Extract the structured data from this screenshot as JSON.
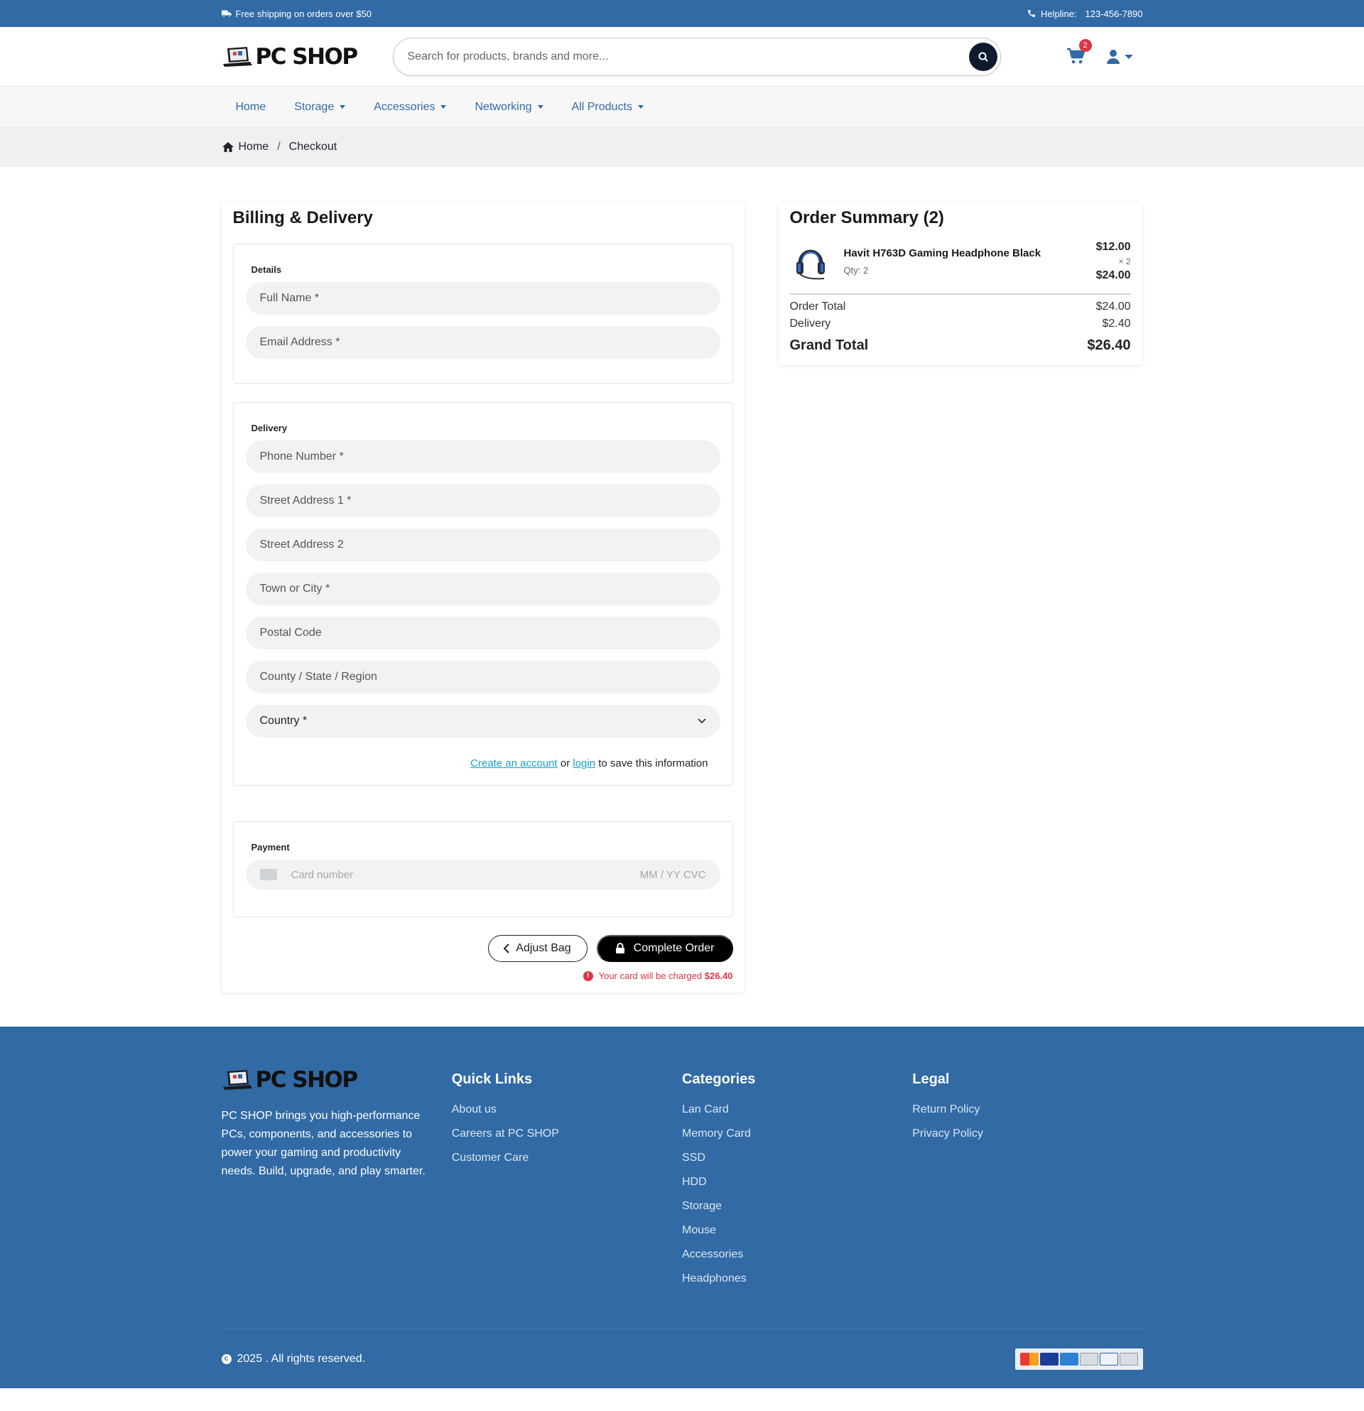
{
  "topbar": {
    "shipping": "Free shipping on orders over $50",
    "helpline_label": "Helpline:",
    "helpline_number": "123-456-7890"
  },
  "header": {
    "logo_text": "PC SHOP",
    "search_placeholder": "Search for products, brands and more...",
    "cart_count": "2"
  },
  "nav": {
    "items": [
      {
        "label": "Home"
      },
      {
        "label": "Storage"
      },
      {
        "label": "Accessories"
      },
      {
        "label": "Networking"
      },
      {
        "label": "All Products"
      }
    ]
  },
  "breadcrumb": {
    "home": "Home",
    "separator": "/",
    "current": "Checkout"
  },
  "billing": {
    "title": "Billing & Delivery",
    "details_label": "Details",
    "full_name": "Full Name *",
    "email": "Email Address *",
    "delivery_label": "Delivery",
    "phone": "Phone Number *",
    "street1": "Street Address 1 *",
    "street2": "Street Address 2",
    "city": "Town or City *",
    "postal": "Postal Code",
    "county": "County / State / Region",
    "country": "Country *",
    "save_create": "Create an account",
    "save_or": "or",
    "save_login": "login",
    "save_suffix": "to save this information",
    "payment_label": "Payment",
    "card_placeholder": "Card number",
    "card_exp": "MM / YY  CVC",
    "adjust_bag": "Adjust Bag",
    "complete_order": "Complete Order",
    "charge_note": "Your card will be charged",
    "charge_amount": "$26.40"
  },
  "summary": {
    "title": "Order Summary (2)",
    "item_name": "Havit H763D Gaming Headphone Black",
    "item_qty": "Qty: 2",
    "item_unit": "$12.00",
    "item_mult": "× 2",
    "item_total": "$24.00",
    "order_total_label": "Order Total",
    "order_total": "$24.00",
    "delivery_label": "Delivery",
    "delivery": "$2.40",
    "grand_label": "Grand Total",
    "grand": "$26.40"
  },
  "footer": {
    "logo_text": "PC SHOP",
    "about": "PC SHOP brings you high-performance PCs, components, and accessories to power your gaming and productivity needs. Build, upgrade, and play smarter.",
    "quick_title": "Quick Links",
    "quick_links": [
      "About us",
      "Careers at PC SHOP",
      "Customer Care"
    ],
    "cat_title": "Categories",
    "categories": [
      "Lan Card",
      "Memory Card",
      "SSD",
      "HDD",
      "Storage",
      "Mouse",
      "Accessories",
      "Headphones"
    ],
    "legal_title": "Legal",
    "legal_links": [
      "Return Policy",
      "Privacy Policy"
    ],
    "copyright": "2025 . All rights reserved."
  },
  "colors": {
    "brand_blue": "#316aa5",
    "danger": "#dc3545",
    "link": "#17a2c8"
  }
}
